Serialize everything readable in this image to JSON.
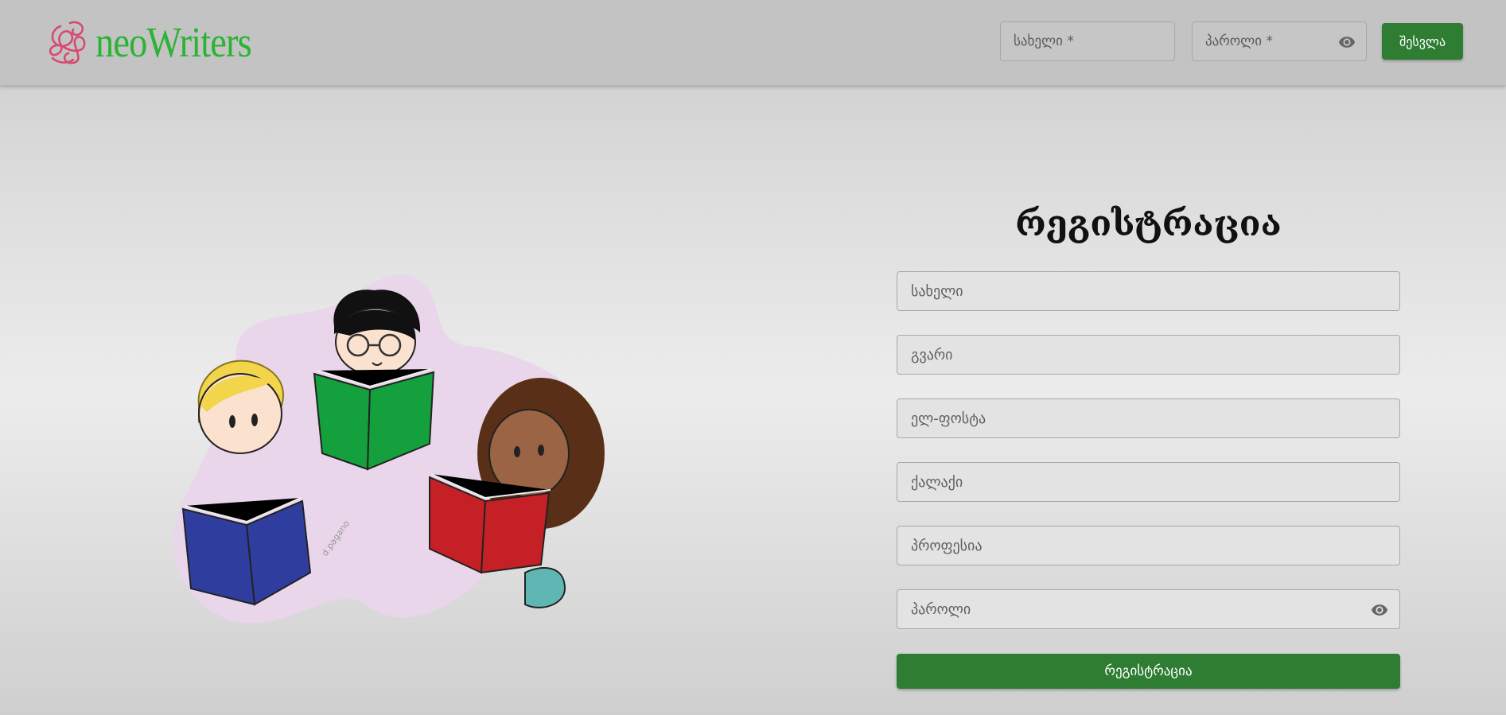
{
  "app": {
    "brand": "neoWriters"
  },
  "header": {
    "username_placeholder": "სახელი *",
    "password_placeholder": "პაროლი *",
    "login_label": "შესვლა"
  },
  "illustration": {
    "signature": "d.pagano"
  },
  "registration": {
    "title": "რეგისტრაცია",
    "fields": [
      {
        "placeholder": "სახელი"
      },
      {
        "placeholder": "გვარი"
      },
      {
        "placeholder": "ელ-ფოსტა"
      },
      {
        "placeholder": "ქალაქი"
      },
      {
        "placeholder": "პროფესია"
      },
      {
        "placeholder": "პაროლი"
      }
    ],
    "submit_label": "რეგისტრაცია"
  },
  "colors": {
    "brand_green": "#2bb334",
    "button_green": "#2e7d32",
    "logo_pink": "#d64b6e",
    "blob": "#ead6ea"
  },
  "icons": {
    "password_toggle": "eye-icon",
    "logo_mark": "scribble-logo-icon"
  }
}
